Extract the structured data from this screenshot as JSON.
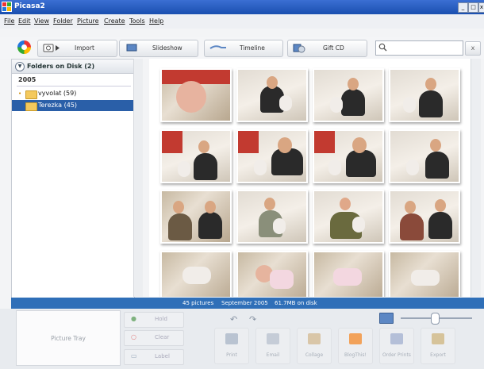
{
  "window": {
    "title": "Picasa2",
    "controls": [
      "_",
      "□",
      "x"
    ]
  },
  "menu": [
    "File",
    "Edit",
    "View",
    "Folder",
    "Picture",
    "Create",
    "Tools",
    "Help"
  ],
  "toolbar": {
    "import_label": "Import",
    "slideshow_label": "Slideshow",
    "timeline_label": "Timeline",
    "giftcd_label": "Gift CD",
    "search_value": "",
    "clear_label": "x"
  },
  "sidebar": {
    "header": "Folders on Disk (2)",
    "year": "2005",
    "folders": [
      {
        "label": "vyvolat (59)",
        "selected": false
      },
      {
        "label": "Terezka (45)",
        "selected": true
      }
    ]
  },
  "status": {
    "count": "45 pictures",
    "date": "September 2005",
    "size": "61.7MB on disk"
  },
  "tray": {
    "label": "Picture Tray",
    "hold_label": "Hold",
    "clear_label": "Clear",
    "label_label": "Label"
  },
  "actions": [
    {
      "label": "Print",
      "icon": "print-icon",
      "color": "#b9c3d1"
    },
    {
      "label": "Email",
      "icon": "email-icon",
      "color": "#c5ccd7"
    },
    {
      "label": "Collage",
      "icon": "collage-icon",
      "color": "#d9c6a8"
    },
    {
      "label": "BlogThis!",
      "icon": "blog-icon",
      "color": "#f2a25a"
    },
    {
      "label": "Order Prints",
      "icon": "order-prints-icon",
      "color": "#b4bfd8"
    },
    {
      "label": "Export",
      "icon": "export-icon",
      "color": "#d6c39a"
    }
  ],
  "colors": {
    "selection": "#2a5fa8",
    "status_bar": "#2f6fb8",
    "titlebar": "#1a4fb0"
  }
}
